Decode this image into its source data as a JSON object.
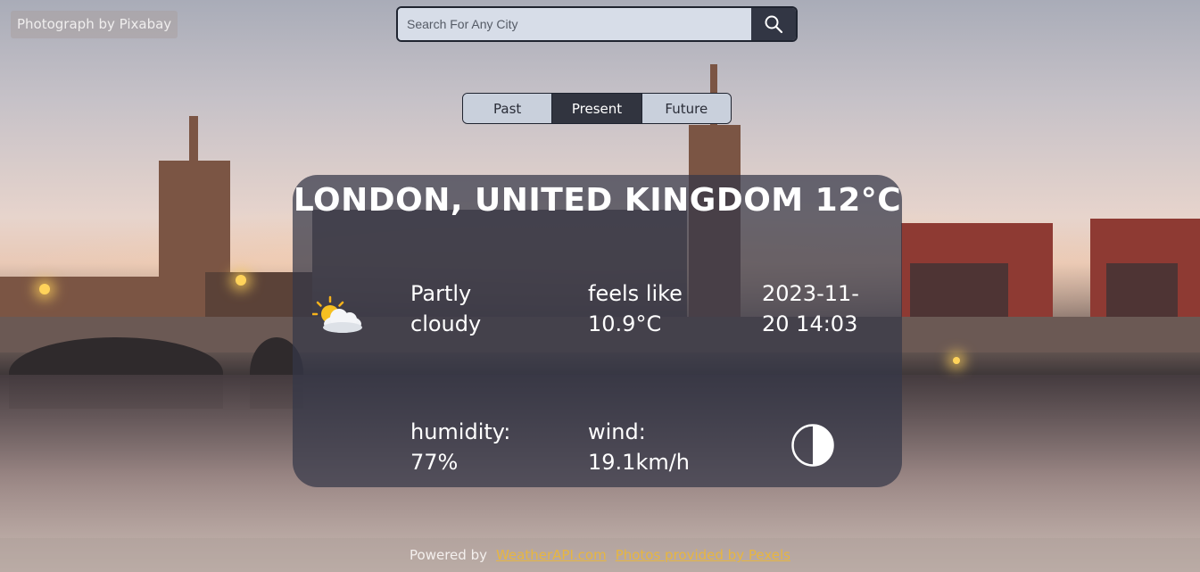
{
  "credit": {
    "text": "Photograph by Pixabay"
  },
  "search": {
    "placeholder": "Search For Any City"
  },
  "tabs": [
    {
      "label": "Past",
      "active": false
    },
    {
      "label": "Present",
      "active": true
    },
    {
      "label": "Future",
      "active": false
    }
  ],
  "weather": {
    "title": "LONDON, UNITED KINGDOM 12°C",
    "condition_icon": "partly-cloudy-icon",
    "condition_line1": "Partly",
    "condition_line2": "cloudy",
    "feels_label": "feels like",
    "feels_value": "10.9°C",
    "date_line1": "2023-11-",
    "date_line2": "20 14:03",
    "humidity_label": "humidity:",
    "humidity_value": "77%",
    "wind_label": "wind:",
    "wind_value": "19.1km/h",
    "moon_icon": "moon-phase-icon"
  },
  "footer": {
    "powered_by": "Powered by",
    "link1": "WeatherAPI.com",
    "link2": "Photos provided by Pexels"
  },
  "colors": {
    "card_bg": "#343848",
    "active_tab": "#31343f",
    "link": "#e7b640"
  }
}
